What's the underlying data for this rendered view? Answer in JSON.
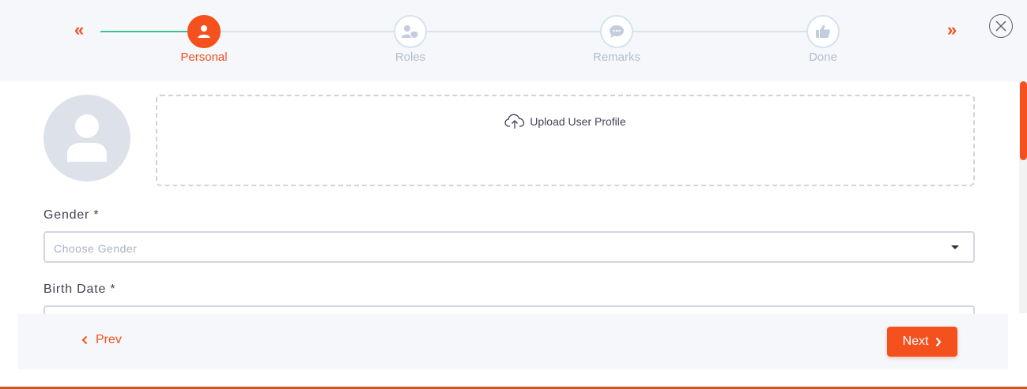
{
  "stepper": {
    "prev_glyph": "«",
    "next_glyph": "»",
    "steps": [
      {
        "label": "Personal",
        "icon": "user-icon",
        "active": true
      },
      {
        "label": "Roles",
        "icon": "user-shield-icon",
        "active": false
      },
      {
        "label": "Remarks",
        "icon": "comment-icon",
        "active": false
      },
      {
        "label": "Done",
        "icon": "thumbs-up-icon",
        "active": false
      }
    ]
  },
  "close": {
    "icon": "close-circle-icon"
  },
  "profile": {
    "avatar_icon": "user-placeholder-icon",
    "upload_icon": "cloud-upload-icon",
    "upload_label": "Upload User Profile"
  },
  "form": {
    "gender": {
      "label": "Gender *",
      "placeholder": "Choose Gender"
    },
    "birth_date": {
      "label": "Birth Date *"
    }
  },
  "footer": {
    "prev_label": "Prev",
    "next_label": "Next"
  },
  "colors": {
    "accent": "#f4511e",
    "progress": "#3ec28f",
    "header_bg": "#f5f7fb"
  }
}
